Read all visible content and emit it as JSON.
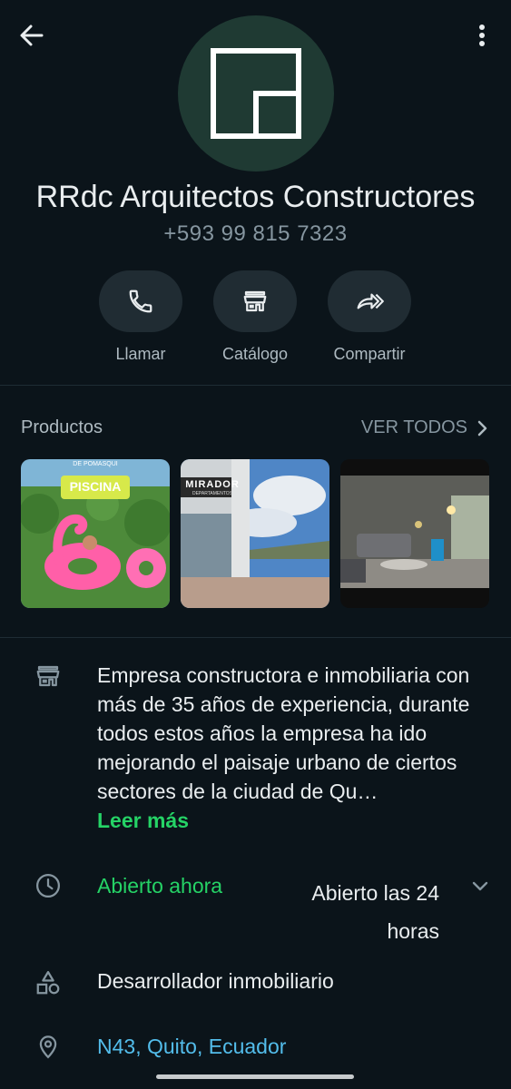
{
  "profile": {
    "name": "RRdc Arquitectos Constructores",
    "phone": "+593 99 815 7323"
  },
  "actions": [
    {
      "label": "Llamar",
      "icon": "phone-icon"
    },
    {
      "label": "Catálogo",
      "icon": "store-icon"
    },
    {
      "label": "Compartir",
      "icon": "share-icon"
    }
  ],
  "products": {
    "title": "Productos",
    "view_all": "VER TODOS",
    "items": [
      {
        "badge": "PISCINA",
        "caption": "DE POMASQUI"
      },
      {
        "sign": "MIRADOR",
        "sign_sub": "DEPARTAMENTOS"
      },
      {
        "name": "living-room"
      }
    ]
  },
  "about": {
    "description": "Empresa constructora e inmobiliaria con más de 35 años de experiencia, durante todos estos años la empresa ha ido mejorando el paisaje urbano de ciertos sectores de la ciudad de Qu…",
    "read_more": "Leer más"
  },
  "hours": {
    "status": "Abierto ahora",
    "detail": "Abierto las 24 horas"
  },
  "category": "Desarrollador inmobiliario",
  "address": "N43, Quito, Ecuador",
  "colors": {
    "background": "#0b141a",
    "accent_green": "#25d366",
    "link_blue": "#53bdeb",
    "logo_bg": "#1f3a33"
  }
}
